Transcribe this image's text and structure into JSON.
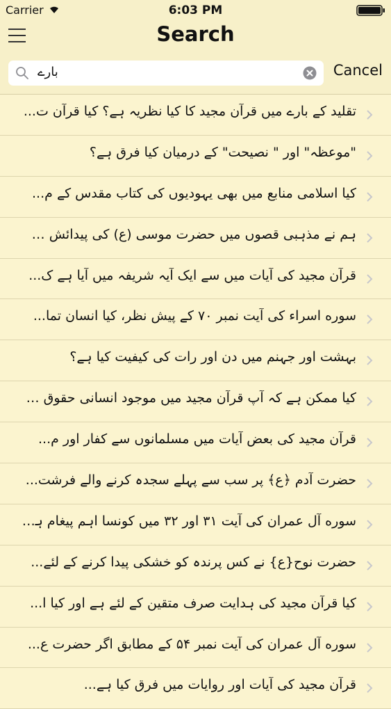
{
  "status": {
    "carrier": "Carrier",
    "time": "6:03 PM"
  },
  "nav": {
    "title": "Search"
  },
  "search": {
    "query": "بارے",
    "cancel_label": "Cancel"
  },
  "results": [
    "تقلید کے بارے میں قرآن مجید کا کیا نظریہ ہے؟ کیا قرآن ت...",
    "\"موعظہ\" اور \" نصیحت\" کے درمیان کیا فرق ہے؟",
    "کیا اسلامی منابع میں بھی یہودیوں کی کتاب مقدس کے م...",
    "ہم نے مذہبی قصوں میں حضرت موسی (ع) کی پیدائش ک...",
    "قرآن مجید کی آیات میں سے ایک آیہ شریفہ میں آیا ہے ک...",
    "سوره اسراء کی آیت نمبر ۷۰ کے پیش نظر، کیا انسان تما...",
    "بہشت اور جہنم میں دن اور رات کی کیفیت کیا ہے؟",
    "کیا ممکن ہے کہ آپ قرآن مجید میں موجود انسانی حقوق م...",
    "قرآن مجید کی بعض آیات میں مسلمانوں سے کفار اور م...",
    "حضرت آدم ﴿ع﴾ پر سب سے پہلے سجدہ کرنے والے فرشت...",
    "سوره آل عمران کی آیت ۳۱ اور ۳۲ میں کونسا اہم پیغام ہے؟",
    "حضرت نوح{ع} نے کس پرندہ کو خشکی پیدا کرنے کے لئے...",
    "کیا قرآن مجید کی ہدایت صرف متقین کے لئے ہے اور کیا ا...",
    "سوره آل عمران کی آیت نمبر ۵۴ کے مطابق اگر حضرت ع...",
    "قرآن مجید کی آیات اور روایات میں فرق کیا ہے..."
  ]
}
